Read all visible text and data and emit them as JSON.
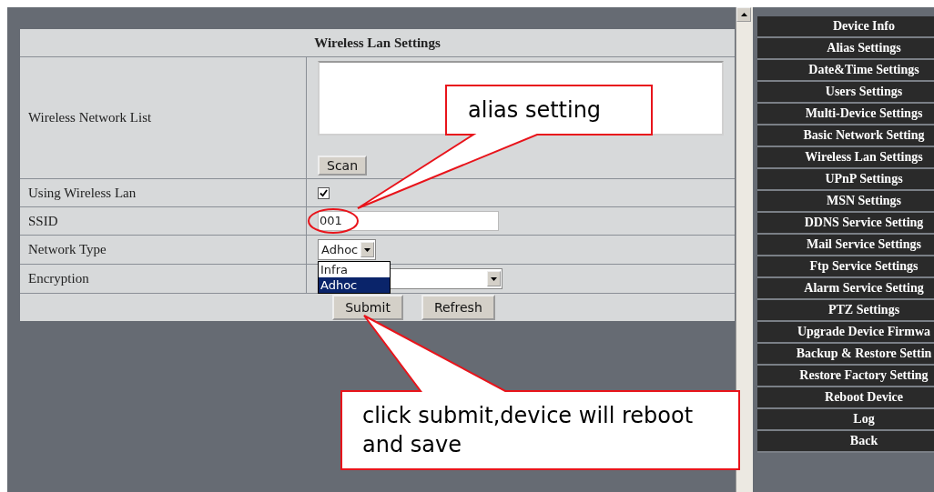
{
  "panel": {
    "title": "Wireless Lan Settings",
    "rows": [
      {
        "kind": "list",
        "label": "Wireless Network List",
        "button": "Scan"
      },
      {
        "kind": "checkbox",
        "label": "Using Wireless Lan",
        "checked": true
      },
      {
        "kind": "text",
        "label": "SSID",
        "value": "001",
        "circled": true
      },
      {
        "kind": "select",
        "label": "Network Type",
        "value": "Adhoc",
        "open": true,
        "options": [
          {
            "label": "Infra",
            "selected": false
          },
          {
            "label": "Adhoc",
            "selected": true
          }
        ]
      },
      {
        "kind": "select",
        "label": "Encryption",
        "value": "",
        "open": false
      }
    ],
    "buttons": [
      "Submit",
      "Refresh"
    ]
  },
  "menu": [
    "Device Info",
    "Alias Settings",
    "Date&Time Settings",
    "Users Settings",
    "Multi-Device Settings",
    "Basic Network Setting",
    "Wireless Lan Settings",
    "UPnP Settings",
    "MSN Settings",
    "DDNS Service Setting",
    "Mail Service Settings",
    "Ftp Service Settings",
    "Alarm Service Setting",
    "PTZ Settings",
    "Upgrade Device Firmwa",
    "Backup & Restore Settin",
    "Restore Factory Setting",
    "Reboot Device",
    "Log",
    "Back"
  ],
  "callouts": [
    {
      "text": "alias setting"
    },
    {
      "text": "click submit,device will reboot and save"
    }
  ]
}
